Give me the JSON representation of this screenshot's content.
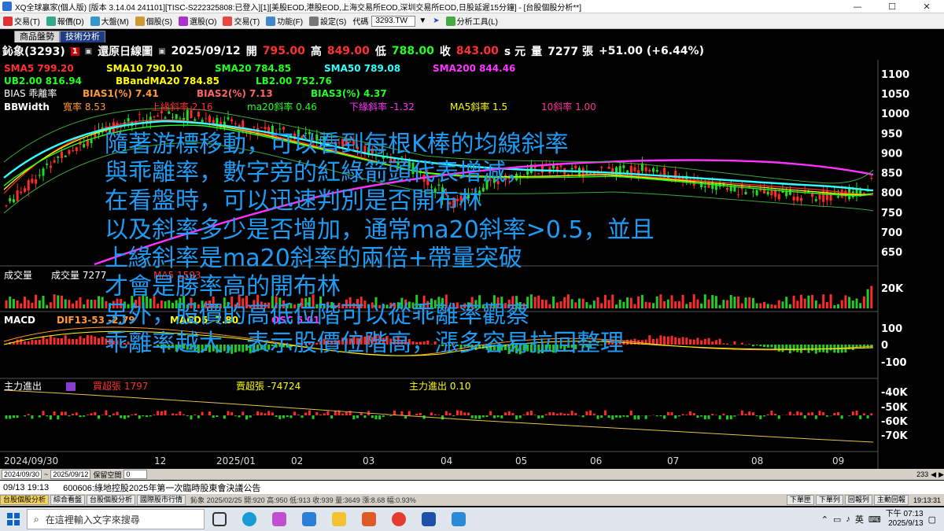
{
  "window": {
    "title": "XQ全球贏家(個人版) [版本 3.14.04 241101][TISC-S222325808:已登入][1][美股EOD,港股EOD,上海交易所EOD,深圳交易所EOD,日股延遲15分鐘] - [台股個股分析**]",
    "minimize": "—",
    "maximize": "☐",
    "close": "✕"
  },
  "menu": {
    "items": [
      "交易(T)",
      "報價(D)",
      "大盤(M)",
      "個股(S)",
      "選股(O)",
      "交易(T)",
      "功能(F)",
      "設定(S)"
    ],
    "code_label": "代碼",
    "code_value": "3293.TW",
    "tool_label": "分析工具(L)"
  },
  "tabs": [
    "商品盤勢",
    "技術分析"
  ],
  "header": {
    "symbol": "鈊象(3293)",
    "badge": "1",
    "chart_mode": "還原日線圖",
    "date": "2025/09/12",
    "open_label": "開",
    "open": "795.00",
    "high_label": "高",
    "high": "849.00",
    "low_label": "低",
    "low": "788.00",
    "close_label": "收",
    "close": "843.00",
    "unit": "s 元",
    "vol_label": "量",
    "vol": "7277 張",
    "change": "+51.00 (+6.44%)"
  },
  "indicators": {
    "row1": [
      "SMA5 799.20",
      "SMA10 790.10",
      "SMA20 784.85",
      "SMA50 789.08",
      "SMA200 844.46"
    ],
    "row2": [
      "UB2.00 816.94",
      "BBandMA20 784.85",
      "LB2.00 752.76"
    ],
    "row3": [
      "BIAS 乖離率",
      "BIAS1(%) 7.41",
      "BIAS2(%) 7.13",
      "BIAS3(%) 4.37"
    ],
    "row4": [
      "BBWidth",
      "寬率 8.53",
      "上緣斜率 2.16",
      "ma20斜率 0.46",
      "下緣斜率 -1.32",
      "MA5斜率 1.5",
      "10斜率 1.00"
    ],
    "volume": [
      "成交量",
      "成交量 7277",
      "MA5 1593"
    ],
    "macd": [
      "MACD",
      "DIF13-53 -2.79",
      "MACD5 -7.80",
      "OSC 5.01"
    ],
    "main_force": [
      "主力進出",
      "買超張 1797",
      "賣超張 -74724",
      "主力進出 0.10"
    ]
  },
  "axes": {
    "price_ticks": [
      "1100",
      "1050",
      "1000",
      "950",
      "900",
      "850",
      "800",
      "750",
      "700",
      "650"
    ],
    "volume_ticks": [
      "20K"
    ],
    "macd_ticks": [
      "100",
      "0",
      "-100"
    ],
    "force_ticks": [
      "-40K",
      "-50K",
      "-60K",
      "-70K"
    ],
    "date_ticks": [
      "2024/09/30",
      "12",
      "2025/01",
      "02",
      "03",
      "04",
      "05",
      "06",
      "07",
      "08",
      "09"
    ]
  },
  "controls": {
    "from": "2024/09/30",
    "to": "2025/09/12",
    "keep_label": "保留空間",
    "keep_value": "0",
    "count": "233"
  },
  "news": {
    "time": "09/13 19:13",
    "text": "600606:綠地控股2025年第一次臨時股東會決議公告"
  },
  "status": {
    "tabs": [
      "台股個股分析",
      "綜合看盤",
      "台股個股分析",
      "國際股市行情"
    ],
    "quote": "鈊象 2025/02/25 開:920 高:950 低:913 收:939 量:3649 漲:8.68 幅:0.93%",
    "buttons": [
      "下單匣",
      "下單列",
      "回報列",
      "主動回報"
    ],
    "time": "19:13:31"
  },
  "taskbar": {
    "search_placeholder": "在這裡輸入文字來搜尋",
    "ime": "英",
    "time_ampm": "下午 07:13",
    "date": "2025/9/13"
  },
  "overlay": {
    "lines": [
      "隨著游標移動，可以看到每根K棒的均線斜率",
      "與乖離率，數字旁的紅綠箭頭代表增減，",
      "在看盤時，可以迅速判別是否開布林",
      "以及斜率多少是否增加，通常ma20斜率>0.5，並且",
      "上緣斜率是ma20斜率的兩倍+帶量突破",
      "才會是勝率高的開布林",
      "另外，股價的高低位階可以從乖離率觀察",
      "乖離率越大，表示股價位階高，漲多容易拉回整理"
    ]
  },
  "colors": {
    "sma5": "#ff3030",
    "sma10": "#ffff00",
    "sma20": "#22ff22",
    "sma50": "#33ffff",
    "sma200": "#ff33ff",
    "overlay_text": "#1e9cf5"
  }
}
